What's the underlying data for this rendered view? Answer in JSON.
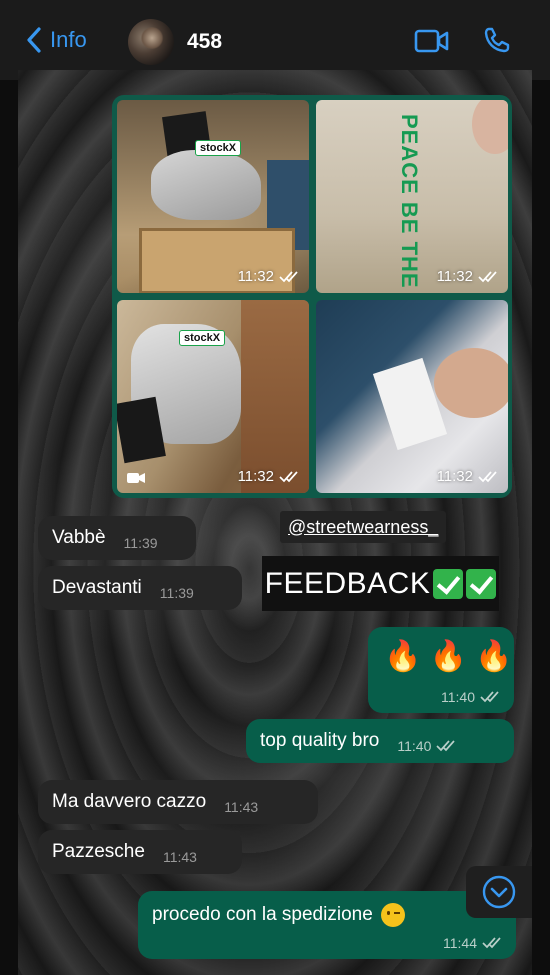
{
  "header": {
    "back_label": "Info",
    "contact_name": "458"
  },
  "icons": {
    "back": "chevron-left-icon",
    "video_call": "video-camera-icon",
    "voice_call": "phone-icon",
    "read": "double-check-icon",
    "scroll_down": "chevron-down-icon"
  },
  "colors": {
    "accent": "#3897f0",
    "outgoing_bubble": "#075e4a",
    "incoming_bubble": "#262626",
    "media_frame": "#0f5a49"
  },
  "media": {
    "tiles": [
      {
        "time": "11:32",
        "type": "photo"
      },
      {
        "time": "11:32",
        "type": "photo",
        "printed_text": "PEACE BE THE JOURNEY"
      },
      {
        "time": "11:32",
        "type": "video"
      },
      {
        "time": "11:32",
        "type": "photo"
      }
    ]
  },
  "stickers": {
    "handle": "@streetwearness_",
    "feedback": "FEEDBACK"
  },
  "messages": [
    {
      "text": "Vabbè",
      "time": "11:39"
    },
    {
      "text": "Devastanti",
      "time": "11:39"
    },
    {
      "text": "🔥 🔥 🔥",
      "time": "11:40"
    },
    {
      "text": "top quality bro",
      "time": "11:40"
    },
    {
      "text": "Ma davvero cazzo",
      "time": "11:43"
    },
    {
      "text": "Pazzesche",
      "time": "11:43"
    },
    {
      "text": "procedo con la spedizione",
      "time": "11:44"
    }
  ]
}
